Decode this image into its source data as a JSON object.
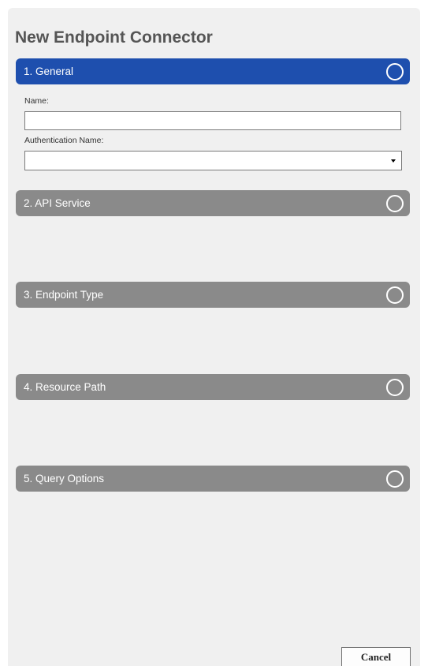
{
  "dialog": {
    "title": "New Endpoint Connector"
  },
  "steps": [
    {
      "label": "1. General",
      "state": "active"
    },
    {
      "label": "2. API Service",
      "state": "inactive"
    },
    {
      "label": "3. Endpoint Type",
      "state": "inactive"
    },
    {
      "label": "4. Resource Path",
      "state": "inactive"
    },
    {
      "label": "5. Query Options",
      "state": "inactive"
    }
  ],
  "general": {
    "name_label": "Name:",
    "name_value": "",
    "auth_label": "Authentication Name:",
    "auth_value": ""
  },
  "footer": {
    "cancel_label": "Cancel"
  },
  "colors": {
    "active_step": "#1e4fae",
    "inactive_step": "#8a8a8a",
    "panel_background": "#f0f0f0",
    "title_text": "#555555"
  },
  "icons": {
    "step_status": "circle-icon",
    "dropdown": "caret-down-icon"
  }
}
